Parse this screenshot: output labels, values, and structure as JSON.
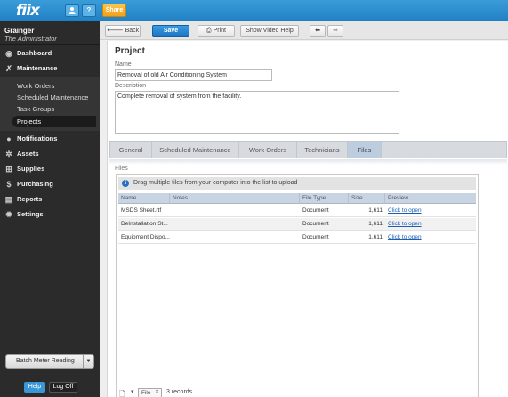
{
  "app": {
    "logo": "fiix",
    "share_label": "Share"
  },
  "user": {
    "name": "Grainger",
    "role": "The Administrator"
  },
  "sidebar": {
    "items": [
      {
        "label": "Dashboard",
        "icon": "dashboard-icon"
      },
      {
        "label": "Maintenance",
        "icon": "wrench-icon"
      },
      {
        "label": "Notifications",
        "icon": "chat-bubble-icon"
      },
      {
        "label": "Assets",
        "icon": "gears-icon"
      },
      {
        "label": "Supplies",
        "icon": "cart-icon"
      },
      {
        "label": "Purchasing",
        "icon": "dollar-icon"
      },
      {
        "label": "Reports",
        "icon": "chart-icon"
      },
      {
        "label": "Settings",
        "icon": "gear-icon"
      }
    ],
    "maintenance_sub": [
      {
        "label": "Work Orders"
      },
      {
        "label": "Scheduled Maintenance"
      },
      {
        "label": "Task Groups"
      },
      {
        "label": "Projects"
      }
    ],
    "batch_label": "Batch Meter Reading",
    "help_label": "Help",
    "logoff_label": "Log Off"
  },
  "toolbar": {
    "back_label": "Back",
    "save_label": "Save",
    "print_label": "Print",
    "video_label": "Show Video Help"
  },
  "project": {
    "title": "Project",
    "name_label": "Name",
    "name_value": "Removal of old Air Conditioning System",
    "description_label": "Description",
    "description_value": "Complete removal of system from the facility."
  },
  "tabs": [
    {
      "label": "General"
    },
    {
      "label": "Scheduled Maintenance"
    },
    {
      "label": "Work Orders"
    },
    {
      "label": "Technicians"
    },
    {
      "label": "Files"
    }
  ],
  "files": {
    "section_label": "Files",
    "info_text": "Drag multiple files from your computer into the list to upload",
    "columns": [
      "Name",
      "Notes",
      "File Type",
      "Size",
      "Preview"
    ],
    "rows": [
      {
        "name": "MSDS Sheet.rtf",
        "notes": "",
        "type": "Document",
        "size": "1,611",
        "preview": "Click to open"
      },
      {
        "name": "DeInstallation St...",
        "notes": "",
        "type": "Document",
        "size": "1,611",
        "preview": "Click to open"
      },
      {
        "name": "Equipment Dispo...",
        "notes": "",
        "type": "Document",
        "size": "1,611",
        "preview": "Click to open"
      }
    ],
    "pager_select": "File",
    "record_count": "3 records."
  },
  "colors": {
    "brand_blue": "#2080c4",
    "share_orange": "#f0a21b",
    "sidebar_bg": "#2b2b2b"
  }
}
